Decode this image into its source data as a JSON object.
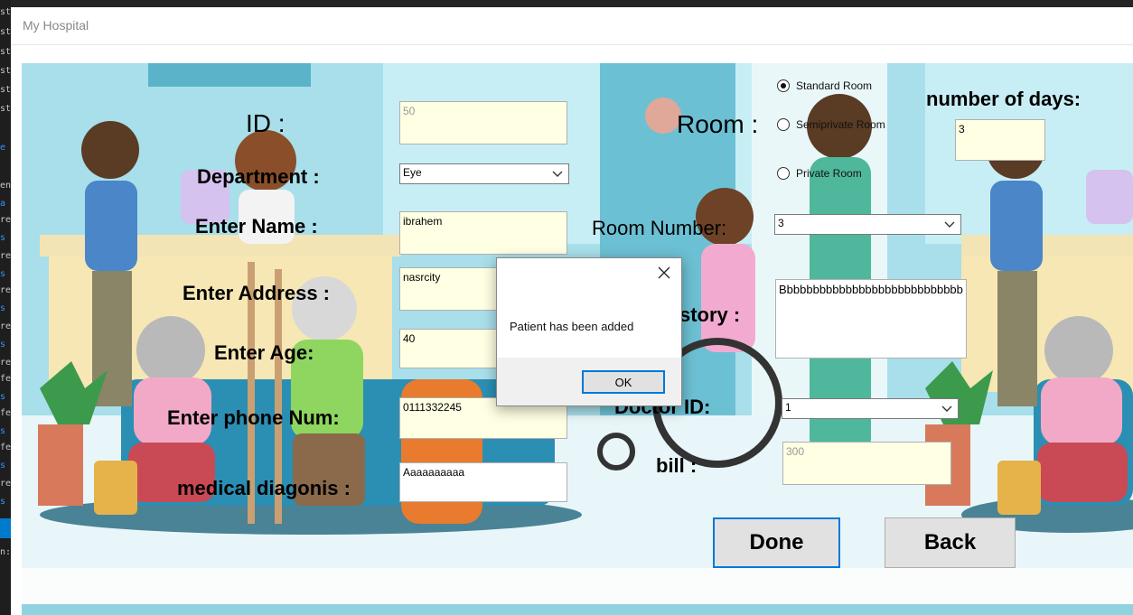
{
  "window": {
    "title": "My Hospital"
  },
  "labels": {
    "id": "ID :",
    "department": "Department :",
    "name": "Enter Name :",
    "address": "Enter Address :",
    "age": "Enter Age:",
    "phone": "Enter phone Num:",
    "diagnosis": "medical diagonis :",
    "room": "Room :",
    "number_of_days": "number of days:",
    "room_number": "Room Number:",
    "history": "History :",
    "doctor_id": "Doctor  ID:",
    "bill": "bill :"
  },
  "fields": {
    "id": "50",
    "department": "Eye",
    "name": "ibrahem",
    "address": "nasrcity",
    "age": "40",
    "phone": "0111332245",
    "diagnosis": "Aaaaaaaaaa",
    "number_of_days": "3",
    "room_number": "3",
    "history": "Bbbbbbbbbbbbbbbbbbbbbbbbbbbb",
    "doctor_id": "1",
    "bill": "300"
  },
  "room_options": [
    {
      "label": "Standard Room",
      "selected": true
    },
    {
      "label": "Semiprivate Room",
      "selected": false
    },
    {
      "label": "Private Room",
      "selected": false
    }
  ],
  "buttons": {
    "done": "Done",
    "back": "Back"
  },
  "dialog": {
    "message": "Patient has been added",
    "ok": "OK"
  },
  "editor_strip": [
    "st",
    "st",
    "st",
    "st",
    "st",
    "st",
    "e",
    "en",
    "a",
    "re",
    "s",
    "re",
    "s",
    "re",
    "s",
    "re",
    "s",
    "re",
    "fe",
    "s",
    "fe",
    "s",
    "fe",
    "s",
    "re",
    "s",
    "re",
    "n:"
  ]
}
